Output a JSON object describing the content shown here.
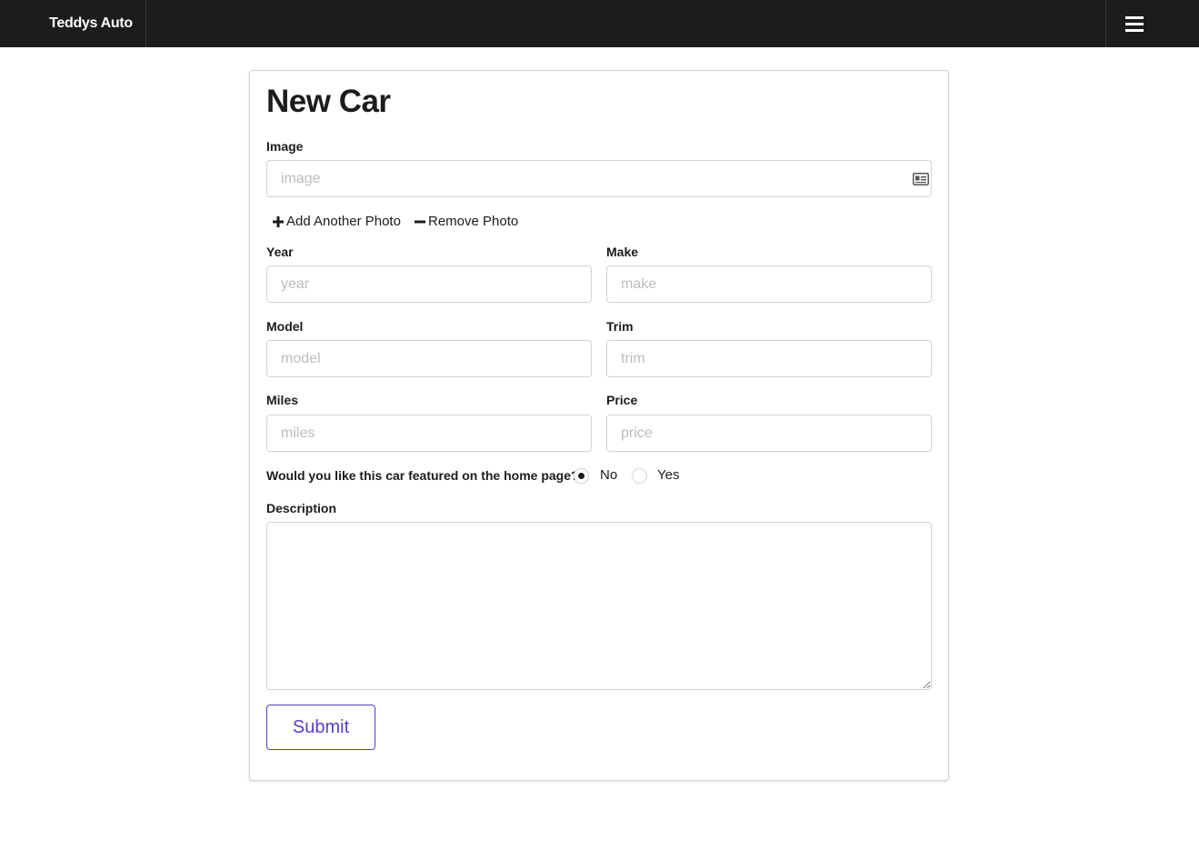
{
  "navbar": {
    "brand": "Teddys Auto",
    "menu_icon": "hamburger-menu-icon"
  },
  "form": {
    "title": "New Car",
    "image": {
      "label": "Image",
      "placeholder": "image",
      "icon": "id-card-icon"
    },
    "photo_actions": {
      "add_label": "Add Another Photo",
      "remove_label": "Remove Photo",
      "add_icon": "plus-icon",
      "remove_icon": "minus-icon"
    },
    "year": {
      "label": "Year",
      "placeholder": "year"
    },
    "make": {
      "label": "Make",
      "placeholder": "make"
    },
    "model": {
      "label": "Model",
      "placeholder": "model"
    },
    "trim": {
      "label": "Trim",
      "placeholder": "trim"
    },
    "miles": {
      "label": "Miles",
      "placeholder": "miles"
    },
    "price": {
      "label": "Price",
      "placeholder": "price"
    },
    "featured": {
      "question": "Would you like this car featured on the home page?",
      "options": [
        "No",
        "Yes"
      ],
      "selected": "No"
    },
    "description": {
      "label": "Description",
      "value": ""
    },
    "submit_label": "Submit"
  },
  "colors": {
    "navbar_bg": "#1b1c1d",
    "accent": "#5b3cc4",
    "border": "#d4d4d5",
    "placeholder": "#bdbdbd"
  }
}
